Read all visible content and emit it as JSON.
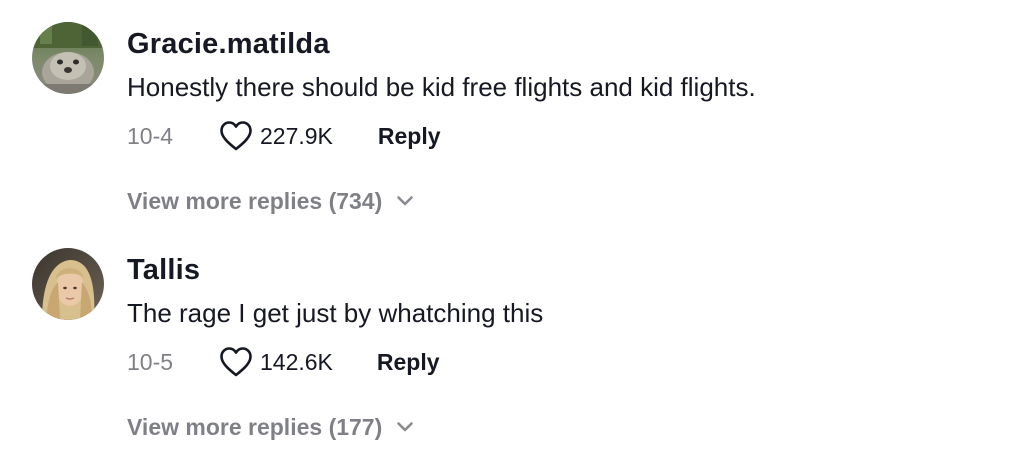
{
  "comments": [
    {
      "username": "Gracie.matilda",
      "text": "Honestly there should be kid free flights and kid flights.",
      "date": "10-4",
      "likes": "227.9K",
      "reply_label": "Reply",
      "view_more_label": "View more replies (734)",
      "avatar_icon": "otter-avatar"
    },
    {
      "username": "Tallis",
      "text": "The rage I get just by whatching this",
      "date": "10-5",
      "likes": "142.6K",
      "reply_label": "Reply",
      "view_more_label": "View more replies (177)",
      "avatar_icon": "person-avatar"
    }
  ],
  "colors": {
    "primary_text": "#161823",
    "secondary_text": "#8a8b91",
    "background": "#ffffff"
  },
  "icons": {
    "like": "heart-icon",
    "expand": "chevron-down-icon"
  }
}
